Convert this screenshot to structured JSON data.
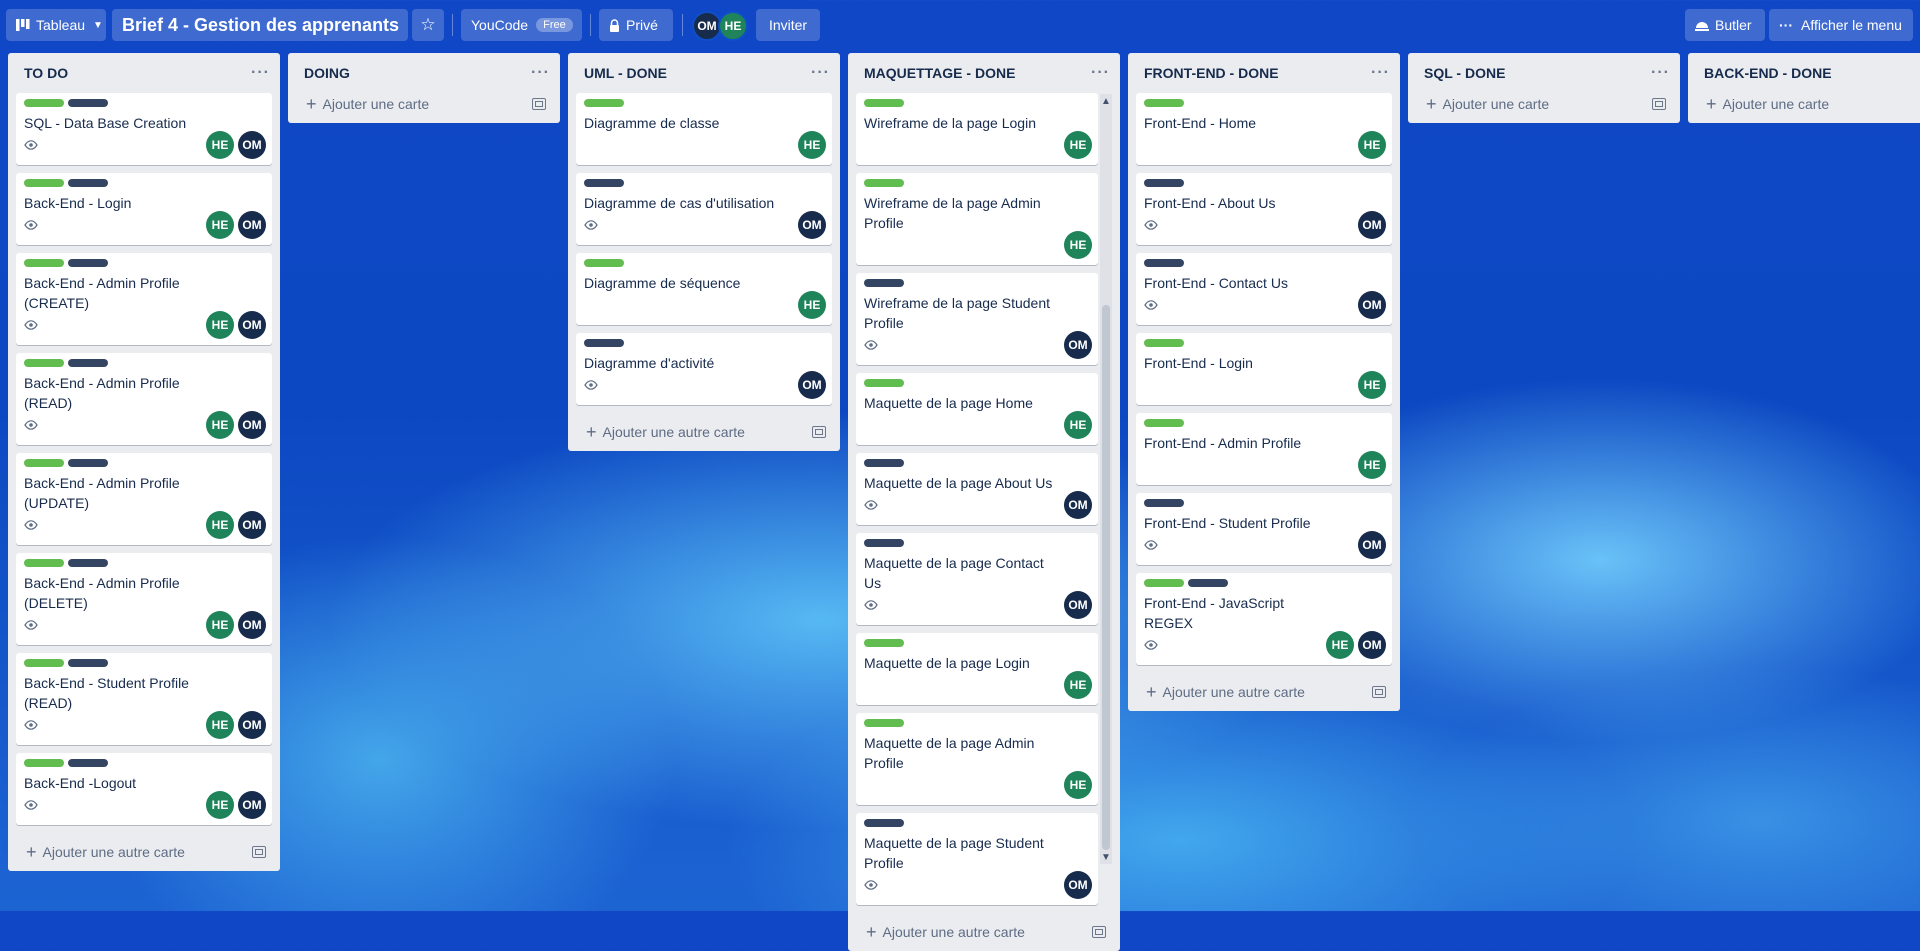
{
  "topbar": {
    "view_label": "Tableau",
    "board_title": "Brief 4 - Gestion des apprenants",
    "workspace": "YouCode",
    "workspace_badge": "Free",
    "visibility": "Privé",
    "members": [
      "OM",
      "HE"
    ],
    "invite_label": "Inviter",
    "butler_label": "Butler",
    "menu_label": "Afficher le menu"
  },
  "colors": {
    "green": "#61bd4f",
    "navy": "#344563",
    "he": "#1f845a",
    "om": "#172b4d"
  },
  "lists": [
    {
      "title": "TO DO",
      "cards": [
        {
          "title": "SQL - Data Base Creation",
          "labels": [
            "green",
            "navy"
          ],
          "eye": true,
          "members": [
            "HE",
            "OM"
          ]
        },
        {
          "title": "Back-End - Login",
          "labels": [
            "green",
            "navy"
          ],
          "eye": true,
          "members": [
            "HE",
            "OM"
          ]
        },
        {
          "title": "Back-End - Admin Profile (CREATE)",
          "labels": [
            "green",
            "navy"
          ],
          "eye": true,
          "members": [
            "HE",
            "OM"
          ]
        },
        {
          "title": "Back-End - Admin Profile (READ)",
          "labels": [
            "green",
            "navy"
          ],
          "eye": true,
          "members": [
            "HE",
            "OM"
          ]
        },
        {
          "title": "Back-End - Admin Profile (UPDATE)",
          "labels": [
            "green",
            "navy"
          ],
          "eye": true,
          "members": [
            "HE",
            "OM"
          ]
        },
        {
          "title": "Back-End - Admin Profile (DELETE)",
          "labels": [
            "green",
            "navy"
          ],
          "eye": true,
          "members": [
            "HE",
            "OM"
          ]
        },
        {
          "title": "Back-End - Student Profile (READ)",
          "labels": [
            "green",
            "navy"
          ],
          "eye": true,
          "members": [
            "HE",
            "OM"
          ]
        },
        {
          "title": "Back-End -Logout",
          "labels": [
            "green",
            "navy"
          ],
          "eye": true,
          "members": [
            "HE",
            "OM"
          ]
        }
      ],
      "add_label": "Ajouter une autre carte"
    },
    {
      "title": "DOING",
      "cards": [],
      "add_label": "Ajouter une carte"
    },
    {
      "title": "UML - DONE",
      "cards": [
        {
          "title": "Diagramme de classe",
          "labels": [
            "green"
          ],
          "eye": false,
          "members": [
            "HE"
          ]
        },
        {
          "title": "Diagramme de cas d'utilisation",
          "labels": [
            "navy"
          ],
          "eye": true,
          "members": [
            "OM"
          ]
        },
        {
          "title": "Diagramme de séquence",
          "labels": [
            "green"
          ],
          "eye": false,
          "members": [
            "HE"
          ]
        },
        {
          "title": "Diagramme d'activité",
          "labels": [
            "navy"
          ],
          "eye": true,
          "members": [
            "OM"
          ]
        }
      ],
      "add_label": "Ajouter une autre carte"
    },
    {
      "title": "MAQUETTAGE - DONE",
      "cards": [
        {
          "title": "Wireframe de la page Login",
          "labels": [
            "green"
          ],
          "eye": false,
          "members": [
            "HE"
          ]
        },
        {
          "title": "Wireframe de la page Admin Profile",
          "labels": [
            "green"
          ],
          "eye": false,
          "members": [
            "HE"
          ]
        },
        {
          "title": "Wireframe de la page Student Profile",
          "labels": [
            "navy"
          ],
          "eye": true,
          "members": [
            "OM"
          ]
        },
        {
          "title": "Maquette de la page Home",
          "labels": [
            "green"
          ],
          "eye": false,
          "members": [
            "HE"
          ]
        },
        {
          "title": "Maquette de la page About Us",
          "labels": [
            "navy"
          ],
          "eye": true,
          "members": [
            "OM"
          ]
        },
        {
          "title": "Maquette de la page Contact Us",
          "labels": [
            "navy"
          ],
          "eye": true,
          "members": [
            "OM"
          ]
        },
        {
          "title": "Maquette de la page Login",
          "labels": [
            "green"
          ],
          "eye": false,
          "members": [
            "HE"
          ]
        },
        {
          "title": "Maquette de la page Admin Profile",
          "labels": [
            "green"
          ],
          "eye": false,
          "members": [
            "HE"
          ]
        },
        {
          "title": "Maquette de la page Student Profile",
          "labels": [
            "navy"
          ],
          "eye": true,
          "members": [
            "OM"
          ]
        }
      ],
      "add_label": "Ajouter une autre carte"
    },
    {
      "title": "FRONT-END - DONE",
      "cards": [
        {
          "title": "Front-End - Home",
          "labels": [
            "green"
          ],
          "eye": false,
          "members": [
            "HE"
          ]
        },
        {
          "title": "Front-End - About Us",
          "labels": [
            "navy"
          ],
          "eye": true,
          "members": [
            "OM"
          ]
        },
        {
          "title": "Front-End - Contact Us",
          "labels": [
            "navy"
          ],
          "eye": true,
          "members": [
            "OM"
          ]
        },
        {
          "title": "Front-End - Login",
          "labels": [
            "green"
          ],
          "eye": false,
          "members": [
            "HE"
          ]
        },
        {
          "title": "Front-End - Admin Profile",
          "labels": [
            "green"
          ],
          "eye": false,
          "members": [
            "HE"
          ]
        },
        {
          "title": "Front-End - Student Profile",
          "labels": [
            "navy"
          ],
          "eye": true,
          "members": [
            "OM"
          ]
        },
        {
          "title": "Front-End - JavaScript REGEX",
          "labels": [
            "green",
            "navy"
          ],
          "eye": true,
          "members": [
            "HE",
            "OM"
          ]
        }
      ],
      "add_label": "Ajouter une autre carte"
    },
    {
      "title": "SQL - DONE",
      "cards": [],
      "add_label": "Ajouter une carte"
    },
    {
      "title": "BACK-END - DONE",
      "cards": [],
      "add_label": "Ajouter une carte"
    }
  ]
}
